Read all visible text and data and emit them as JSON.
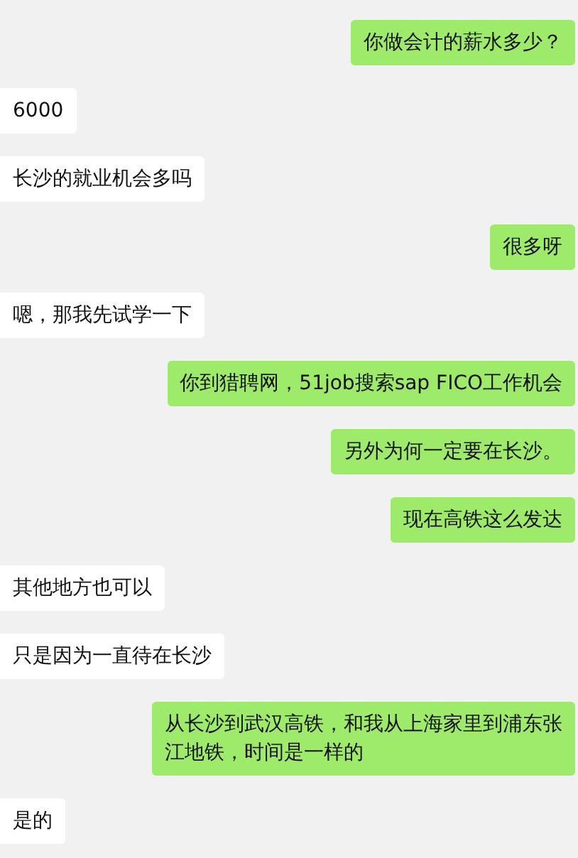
{
  "messages": [
    {
      "kind": "sent",
      "text": "你做会计的薪水多少？"
    },
    {
      "kind": "received",
      "text": "6000"
    },
    {
      "kind": "received",
      "text": "长沙的就业机会多吗"
    },
    {
      "kind": "sent",
      "text": "很多呀"
    },
    {
      "kind": "received",
      "text": "嗯，那我先试学一下"
    },
    {
      "kind": "sent",
      "text": "你到猎聘网，51job搜索sap FICO工作机会"
    },
    {
      "kind": "sent",
      "text": "另外为何一定要在长沙。"
    },
    {
      "kind": "sent",
      "text": "现在高铁这么发达"
    },
    {
      "kind": "received",
      "text": "其他地方也可以"
    },
    {
      "kind": "received",
      "text": "只是因为一直待在长沙"
    },
    {
      "kind": "sent",
      "text": "从长沙到武汉高铁，和我从上海家里到浦东张江地铁，时间是一样的"
    },
    {
      "kind": "received",
      "text": "是的"
    }
  ]
}
